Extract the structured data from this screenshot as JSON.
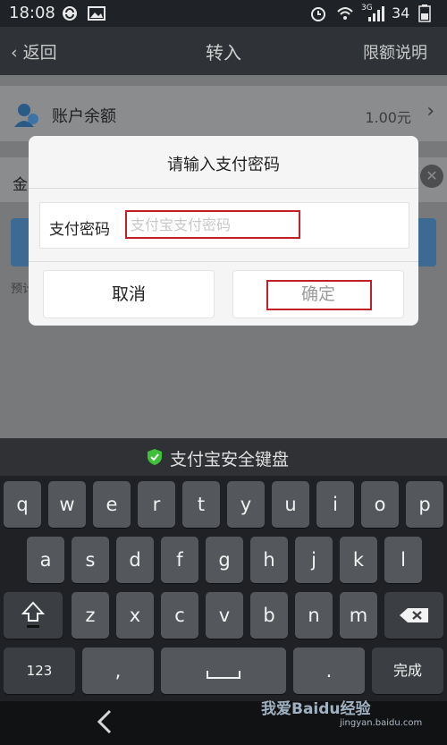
{
  "status_bar": {
    "time": "18:08",
    "network": "3G",
    "battery": "34"
  },
  "header": {
    "back_label": "返回",
    "title": "转入",
    "right_link": "限额说明"
  },
  "page": {
    "balance_label": "账户余额",
    "balance_value": "1.00元",
    "amount_label_partial": "金",
    "hint_partial": "预计"
  },
  "dialog": {
    "title": "请输入支付密码",
    "field_label": "支付密码",
    "password_placeholder": "支付宝支付密码",
    "password_value": "",
    "cancel_label": "取消",
    "confirm_label": "确定"
  },
  "keyboard": {
    "title": "支付宝安全键盘",
    "row1": [
      "q",
      "w",
      "e",
      "r",
      "t",
      "y",
      "u",
      "i",
      "o",
      "p"
    ],
    "row2": [
      "a",
      "s",
      "d",
      "f",
      "g",
      "h",
      "j",
      "k",
      "l"
    ],
    "row3": [
      "z",
      "x",
      "c",
      "v",
      "b",
      "n",
      "m"
    ],
    "mode_label": "123",
    "comma": ",",
    "period": ".",
    "done_label": "完成"
  },
  "watermark": {
    "text": "我爱Baidu经验",
    "url": "jingyan.baidu.com"
  },
  "colors": {
    "highlight": "#c0202a",
    "keyboard_key": "#54575b",
    "dialog_bg": "#f5f5f5"
  }
}
